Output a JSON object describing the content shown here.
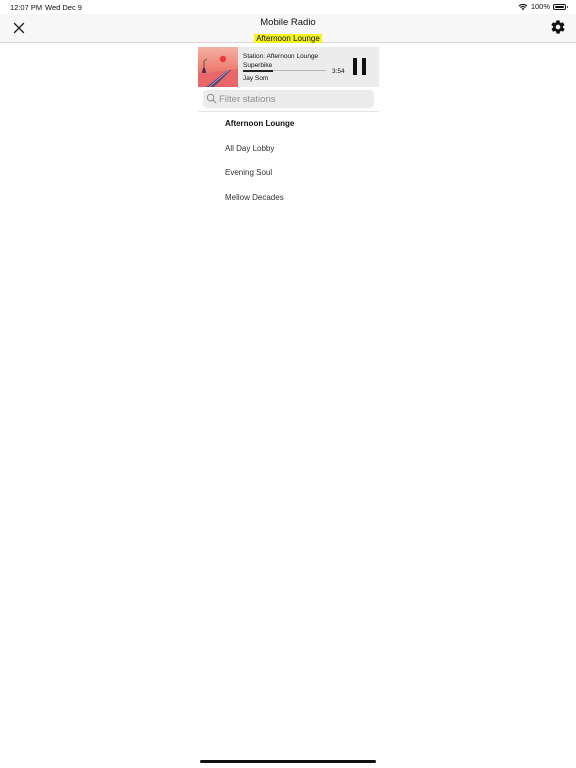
{
  "status_bar": {
    "time": "12:07 PM",
    "date": "Wed Dec 9",
    "battery": "100%",
    "wifi_icon": "wifi-icon",
    "battery_icon": "battery-icon"
  },
  "nav": {
    "title": "Mobile Radio",
    "subtitle": "Afternoon Lounge",
    "subtitle_highlight_color": "#f5f51f",
    "close_icon": "close-icon",
    "settings_icon": "gear-icon"
  },
  "player": {
    "station_text": "Station: Afternoon Lounge",
    "track": "Superbike",
    "artist": "Jay Som",
    "time_remaining": "3:54",
    "progress_fraction": 0.36,
    "album_art_icon": "album-art",
    "pause_icon": "pause-icon"
  },
  "search": {
    "placeholder": "Filter stations",
    "value": "",
    "icon": "search-icon"
  },
  "stations": [
    {
      "label": "Afternoon Lounge",
      "active": true
    },
    {
      "label": "All Day Lobby",
      "active": false
    },
    {
      "label": "Evening Soul",
      "active": false
    },
    {
      "label": "Mellow Decades",
      "active": false
    }
  ]
}
